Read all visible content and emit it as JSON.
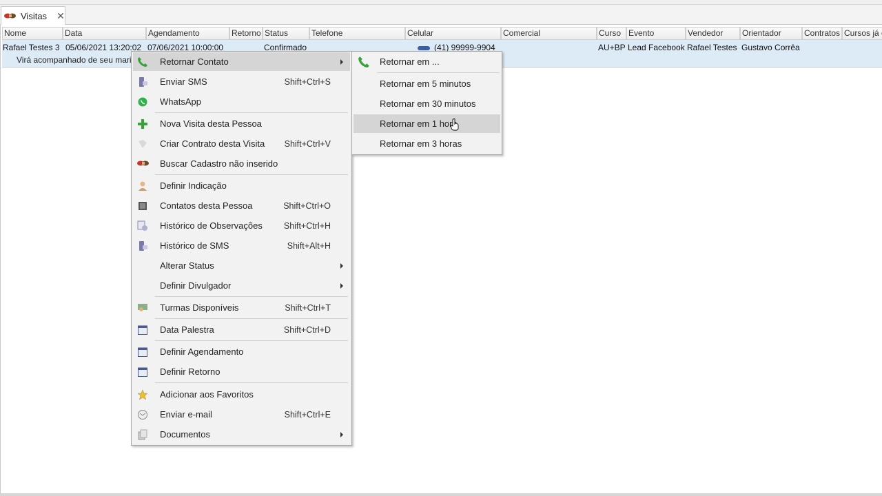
{
  "tab": {
    "label": "Visitas",
    "close": "✕"
  },
  "grid": {
    "columns": [
      "Nome",
      "Data",
      "Agendamento",
      "Retorno",
      "Status",
      "Telefone",
      "Celular",
      "Comercial",
      "Curso",
      "Evento",
      "Vendedor",
      "Orientador",
      "Contratos",
      "Cursos já c"
    ],
    "row": {
      "nome": "Rafael Testes 3",
      "data": "05/06/2021 13:20:02",
      "agendamento": "07/06/2021 10:00:00",
      "status": "Confirmado",
      "celular": "(41) 99999-9904",
      "curso": "AU+BP",
      "evento": "Lead Facebook",
      "vendedor": "Rafael Testes",
      "orientador": "Gustavo Corrêa",
      "note": "Virá acompanhado de seu marido"
    }
  },
  "menu": {
    "items": [
      {
        "label": "Retornar Contato",
        "shortcut": "",
        "submenu": true,
        "icon": "phone-icon"
      },
      {
        "label": "Enviar SMS",
        "shortcut": "Shift+Ctrl+S",
        "icon": "sms-icon"
      },
      {
        "label": "WhatsApp",
        "shortcut": "",
        "icon": "whatsapp-icon"
      },
      {
        "label": "Nova Visita desta Pessoa",
        "shortcut": "",
        "icon": "plus-icon"
      },
      {
        "label": "Criar Contrato desta Visita",
        "shortcut": "Shift+Ctrl+V",
        "icon": "contract-icon"
      },
      {
        "label": "Buscar Cadastro não inserido",
        "shortcut": "",
        "icon": "handshake-icon"
      },
      {
        "label": "Definir Indicação",
        "shortcut": "",
        "icon": "person-icon"
      },
      {
        "label": "Contatos desta Pessoa",
        "shortcut": "Shift+Ctrl+O",
        "icon": "contacts-icon"
      },
      {
        "label": "Histórico de Observações",
        "shortcut": "Shift+Ctrl+H",
        "icon": "notes-history-icon"
      },
      {
        "label": "Histórico de SMS",
        "shortcut": "Shift+Alt+H",
        "icon": "sms-history-icon"
      },
      {
        "label": "Alterar Status",
        "shortcut": "",
        "submenu": true
      },
      {
        "label": "Definir Divulgador",
        "shortcut": "",
        "submenu": true
      },
      {
        "label": "Turmas Disponíveis",
        "shortcut": "Shift+Ctrl+T",
        "icon": "class-icon"
      },
      {
        "label": "Data Palestra",
        "shortcut": "Shift+Ctrl+D",
        "icon": "calendar-icon"
      },
      {
        "label": "Definir Agendamento",
        "shortcut": "",
        "icon": "calendar-icon"
      },
      {
        "label": "Definir Retorno",
        "shortcut": "",
        "icon": "calendar-icon"
      },
      {
        "label": "Adicionar aos Favoritos",
        "shortcut": "",
        "icon": "star-icon"
      },
      {
        "label": "Enviar e-mail",
        "shortcut": "Shift+Ctrl+E",
        "icon": "email-icon"
      },
      {
        "label": "Documentos",
        "shortcut": "",
        "submenu": true,
        "icon": "documents-icon"
      }
    ]
  },
  "submenu": {
    "items": [
      {
        "label": "Retornar em ..."
      },
      {
        "label": "Retornar em 5 minutos"
      },
      {
        "label": "Retornar em 30 minutos"
      },
      {
        "label": "Retornar em 1 hora",
        "highlighted": true
      },
      {
        "label": "Retornar em 3 horas"
      }
    ]
  },
  "colors": {
    "row_selected": "#ddebf7",
    "menu_bg": "#f2f2f2",
    "menu_highlight": "#d5d5d5",
    "phone_green": "#3aa23a"
  }
}
